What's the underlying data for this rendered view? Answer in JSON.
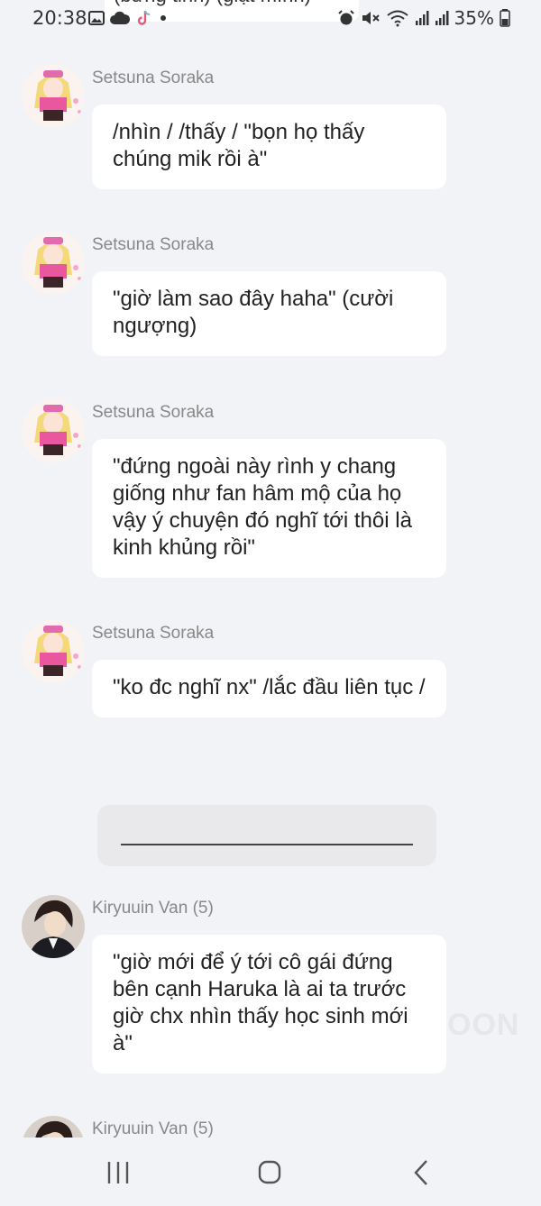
{
  "status_bar": {
    "time": "20:38",
    "battery": "35%",
    "left_icons": [
      "image-icon",
      "cloud-icon",
      "tiktok-icon",
      "dot-icon"
    ],
    "right_icons": [
      "alarm-icon",
      "mute-icon",
      "wifi-icon",
      "signal-icon",
      "signal-icon",
      "battery-icon"
    ]
  },
  "top_clipped_message": "(bừng tỉnh) (giật mình)",
  "messages": [
    {
      "sender": "Setsuna Soraka",
      "text": "/nhìn / /thấy / \"bọn họ thấy chúng mik rồi à\""
    },
    {
      "sender": "Setsuna Soraka",
      "text": "\"giờ làm sao đây haha\" (cười ngượng)"
    },
    {
      "sender": "Setsuna Soraka",
      "text": "\"đứng ngoài này rình y chang giống như fan hâm mộ của họ vậy ý chuyện đó nghĩ tới thôi là kinh khủng rồi\""
    },
    {
      "sender": "Setsuna Soraka",
      "text": "\"ko đc nghĩ nx\" /lắc đầu liên tục /"
    },
    {
      "sender": "Kiryuuin Van (5)",
      "text": "\"giờ mới để ý tới cô gái đứng bên cạnh Haruka là ai ta trước giờ chx nhìn thấy học sinh mới à\""
    },
    {
      "sender": "Kiryuuin Van (5)",
      "text": ""
    }
  ],
  "watermark": "OON",
  "nav": {
    "recents": "recents-icon",
    "home": "home-icon",
    "back": "back-icon"
  },
  "colors": {
    "background": "#f2f3f6",
    "bubble": "#ffffff",
    "sender": "#888888",
    "divider_box": "#e9e9eb"
  }
}
